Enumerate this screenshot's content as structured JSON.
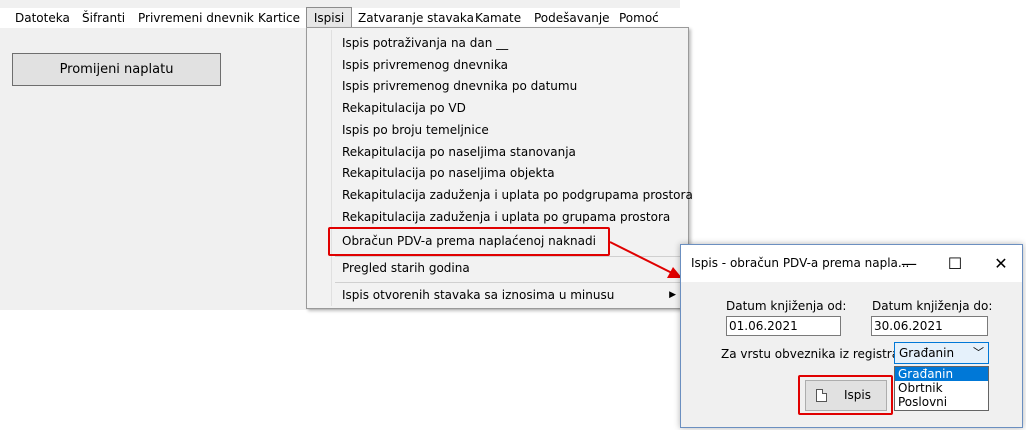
{
  "menubar": {
    "items": [
      "Datoteka",
      "Šifranti",
      "Privremeni dnevnik",
      "Kartice",
      "Ispisi",
      "Zatvaranje stavaka",
      "Kamate",
      "Podešavanje",
      "Pomoć"
    ]
  },
  "main": {
    "button_label": "Promijeni naplatu"
  },
  "dropdown": {
    "items": [
      "Ispis potraživanja na dan __",
      "Ispis privremenog dnevnika",
      "Ispis privremenog dnevnika po datumu",
      "Rekapitulacija po VD",
      "Ispis po broju temeljnice",
      "Rekapitulacija po naseljima stanovanja",
      "Rekapitulacija po naseljima objekta",
      "Rekapitulacija zaduženja i uplata po podgrupama prostora",
      "Rekapitulacija zaduženja i uplata po grupama prostora",
      "Obračun PDV-a prema naplaćenoj naknadi",
      "Pregled starih godina",
      "Ispis otvorenih stavaka sa iznosima u minusu"
    ],
    "submenu_arrow": "▶"
  },
  "dialog": {
    "title": "Ispis - obračun PDV-a prema napla...",
    "minimize": "—",
    "maximize": "☐",
    "close": "✕",
    "date_from_label": "Datum knjiženja od:",
    "date_from_value": "01.06.2021",
    "date_to_label": "Datum knjiženja do:",
    "date_to_value": "30.06.2021",
    "registry_label": "Za vrstu obveznika iz registra:",
    "registry_selected": "Građanin",
    "registry_options": [
      "Građanin",
      "Obrtnik",
      "Poslovni"
    ],
    "print_button": "Ispis"
  },
  "colors": {
    "highlight": "#e00000",
    "selection": "#0078d7"
  }
}
